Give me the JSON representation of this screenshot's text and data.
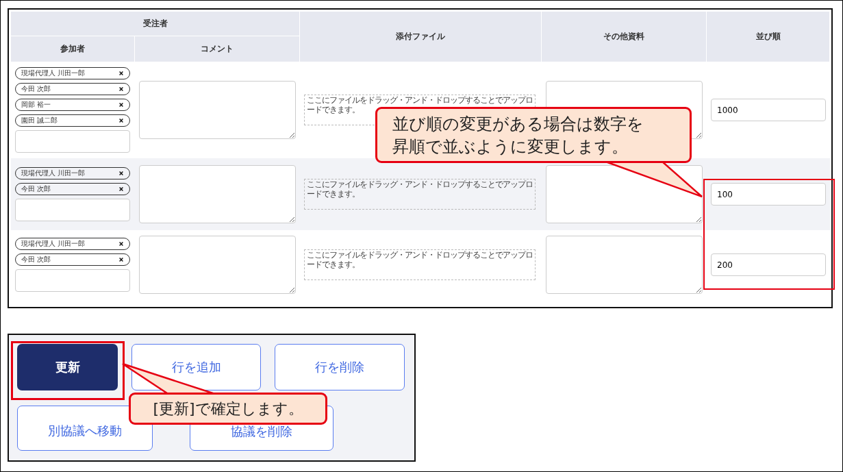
{
  "table": {
    "group_header": "受注者",
    "columns": [
      "参加者",
      "コメント",
      "添付ファイル",
      "その他資料",
      "並び順"
    ],
    "rows": [
      {
        "participants": [
          "現場代理人 川田一郎",
          "今田 次郎",
          "岡部 裕一",
          "園田 誠二郎"
        ],
        "drop_hint": "ここにファイルをドラッグ・アンド・ドロップすることでアップロードできます。",
        "order": "1000",
        "shaded": false
      },
      {
        "participants": [
          "現場代理人 川田一郎",
          "今田 次郎"
        ],
        "drop_hint": "ここにファイルをドラッグ・アンド・ドロップすることでアップロードできます。",
        "order": "100",
        "shaded": true
      },
      {
        "participants": [
          "現場代理人 川田一郎",
          "今田 次郎"
        ],
        "drop_hint": "ここにファイルをドラッグ・アンド・ドロップすることでアップロードできます。",
        "order": "200",
        "shaded": false
      }
    ]
  },
  "buttons": [
    {
      "label": "更新",
      "kind": "primary"
    },
    {
      "label": "行を追加",
      "kind": "outline"
    },
    {
      "label": "行を削除",
      "kind": "outline"
    },
    {
      "label": "別協議へ移動",
      "kind": "outline"
    },
    {
      "label": "協議を削除",
      "kind": "outline"
    }
  ],
  "callouts": [
    {
      "text": "並び順の変更がある場合は数字を昇順で並ぶように変更します。"
    },
    {
      "text": "[更新]で確定します。"
    }
  ]
}
